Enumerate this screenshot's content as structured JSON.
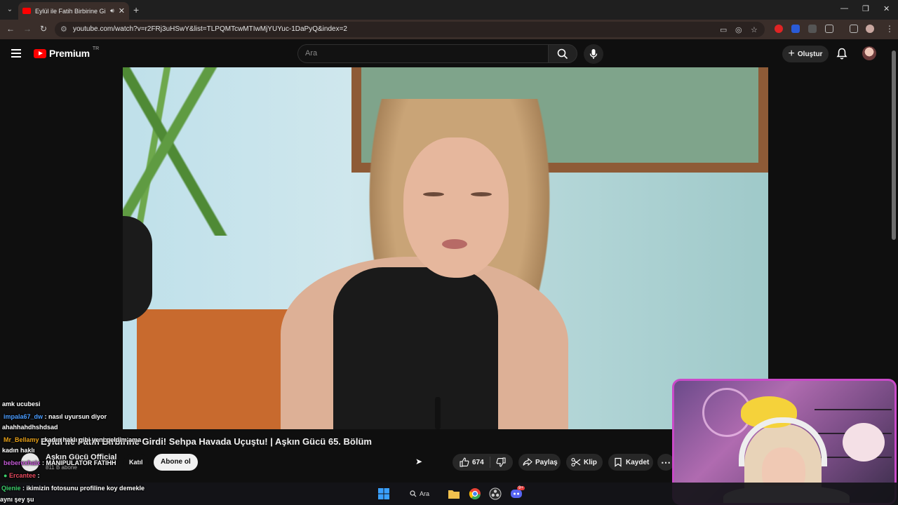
{
  "browser": {
    "tab_title": "Eylül ile Fatih Birbirine Girdi",
    "url": "youtube.com/watch?v=r2FRj3uHSwY&list=TLPQMTcwMTIwMjYUYuc-1DaPyQ&index=2"
  },
  "youtube": {
    "logo_text": "Premium",
    "logo_region": "TR",
    "search_placeholder": "Ara",
    "create_label": "Oluştur"
  },
  "video": {
    "title": "Eylül ile Fatih Birbirine Girdi! Sehpa Havada Uçuştu! | Aşkın Gücü 65. Bölüm",
    "channel": "Aşkın Gücü Official",
    "subscribers": "811 B abone",
    "join_label": "Katıl",
    "subscribe_label": "Abone ol",
    "likes": "674",
    "share_label": "Paylaş",
    "clip_label": "Klip",
    "save_label": "Kaydet"
  },
  "chat": [
    {
      "user": "",
      "message": "amk ucubesi",
      "user_color": "#ffffff"
    },
    {
      "user": "impala67_dw",
      "message": ": nasıl uyursun diyor",
      "user_color": "#4a9cff"
    },
    {
      "user": "",
      "message": "ahahhahdhshdsad",
      "user_color": "#ffffff"
    },
    {
      "user": "Mr_Bellamy",
      "message": ": kadın haklı gibi yeni geldim ama",
      "user_color": "#e6a019"
    },
    {
      "user": "",
      "message": "kadın haklı",
      "user_color": "#ffffff"
    },
    {
      "user": "beberexhaix",
      "message": ": MANIPULATOR FATIHH",
      "user_color": "#c45ad6"
    },
    {
      "user": "Ercantee",
      "message": ":",
      "user_color": "#e84a5f"
    },
    {
      "user": "Qienie",
      "message": ": ikimizin fotosunu profiline koy demekle",
      "user_color": "#3ccf6a"
    },
    {
      "user": "",
      "message": "aynı şey şu",
      "user_color": "#ffffff"
    }
  ],
  "taskbar": {
    "search_label": "Ara",
    "discord_badge": "9+"
  },
  "colors": {
    "youtube_red": "#ff0000",
    "webcam_border": "#c94ac8"
  }
}
